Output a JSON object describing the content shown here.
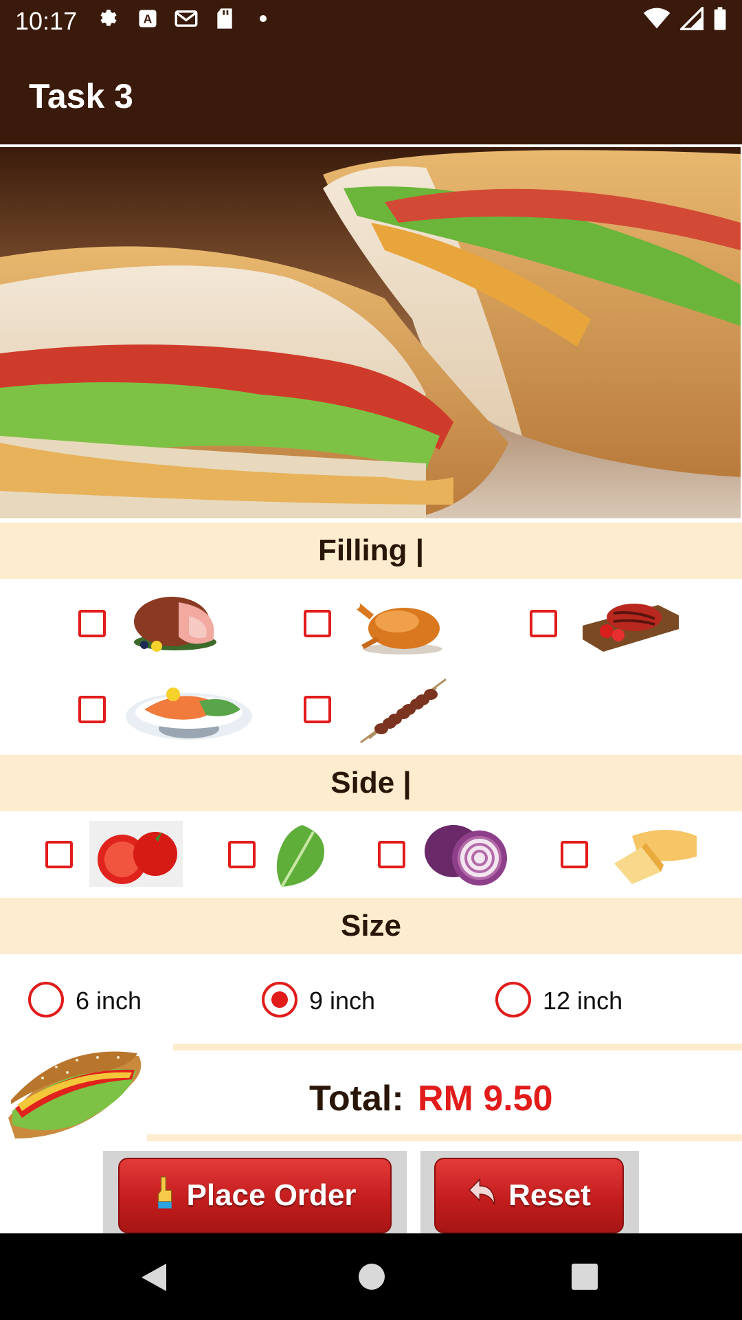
{
  "status_bar": {
    "time": "10:17",
    "left_icons": [
      "settings-icon",
      "a-box-icon",
      "gmail-icon",
      "sd-card-icon",
      "dot-icon"
    ],
    "right_icons": [
      "wifi-icon",
      "signal-icon",
      "battery-icon"
    ]
  },
  "app_bar": {
    "title": "Task 3"
  },
  "hero": {
    "alt": "sandwich-photo"
  },
  "filling": {
    "header": "Filling |",
    "items": [
      {
        "icon": "ham-icon",
        "checked": false
      },
      {
        "icon": "roast-chicken-icon",
        "checked": false
      },
      {
        "icon": "steak-icon",
        "checked": false
      },
      {
        "icon": "salmon-plate-icon",
        "checked": false
      },
      {
        "icon": "kebab-skewers-icon",
        "checked": false
      }
    ]
  },
  "side": {
    "header": "Side |",
    "items": [
      {
        "icon": "tomato-icon",
        "checked": false
      },
      {
        "icon": "lettuce-icon",
        "checked": false
      },
      {
        "icon": "onion-icon",
        "checked": false
      },
      {
        "icon": "cheese-icon",
        "checked": false
      }
    ]
  },
  "size": {
    "header": "Size",
    "options": [
      {
        "label": "6 inch",
        "checked": false
      },
      {
        "label": "9 inch",
        "checked": true
      },
      {
        "label": "12 inch",
        "checked": false
      }
    ]
  },
  "total": {
    "label": "Total:",
    "value": "RM 9.50"
  },
  "buttons": {
    "place_order": "Place Order",
    "reset": "Reset"
  },
  "colors": {
    "bar": "#3a1a0a",
    "accent": "#e21b1b",
    "section": "#fdeccd"
  }
}
